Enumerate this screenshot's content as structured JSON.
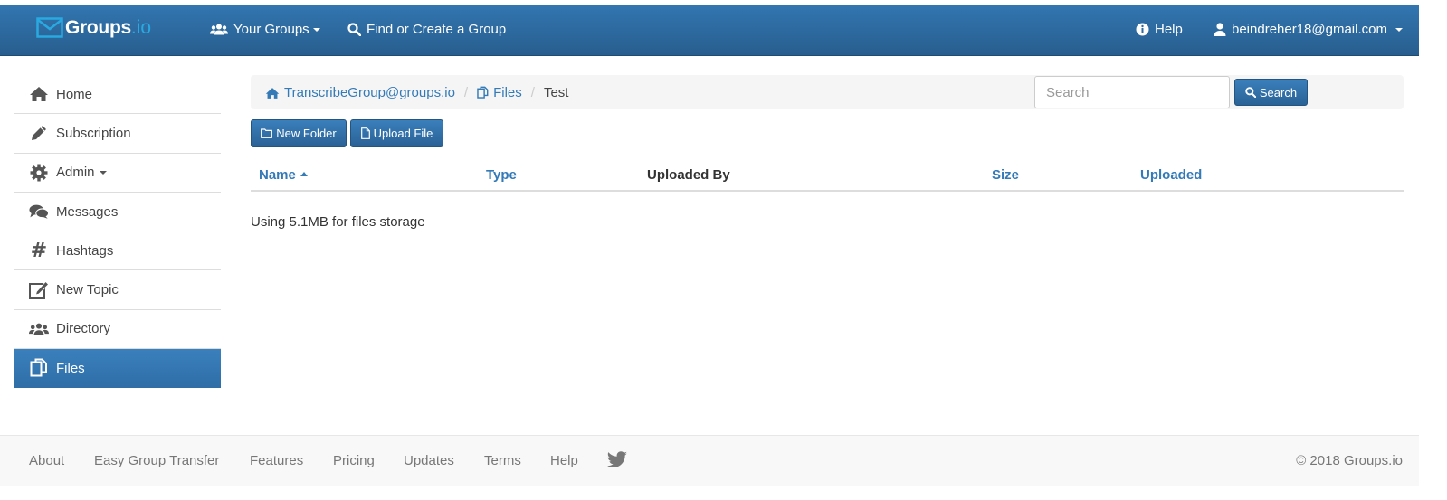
{
  "navbar": {
    "brand": "Groups",
    "brand_suffix": ".io",
    "your_groups": "Your Groups",
    "find_create": "Find or Create a Group",
    "help": "Help",
    "user_email": "beindreher18@gmail.com"
  },
  "sidebar": {
    "items": [
      {
        "label": "Home",
        "icon": "home-icon"
      },
      {
        "label": "Subscription",
        "icon": "pencil-icon"
      },
      {
        "label": "Admin",
        "icon": "gear-icon"
      },
      {
        "label": "Messages",
        "icon": "chat-icon"
      },
      {
        "label": "Hashtags",
        "icon": "hashtag-icon"
      },
      {
        "label": "New Topic",
        "icon": "edit-icon"
      },
      {
        "label": "Directory",
        "icon": "users-icon"
      },
      {
        "label": "Files",
        "icon": "files-icon"
      }
    ],
    "active": "Files"
  },
  "breadcrumb": {
    "group": "TranscribeGroup@groups.io",
    "files": "Files",
    "current": "Test",
    "separator": "/"
  },
  "search": {
    "placeholder": "Search",
    "button": "Search"
  },
  "toolbar": {
    "new_folder": "New Folder",
    "upload_file": "Upload File"
  },
  "table": {
    "columns": [
      "Name",
      "Type",
      "Uploaded By",
      "Size",
      "Uploaded"
    ],
    "sorted_by": "Name"
  },
  "storage_text": "Using 5.1MB for files storage",
  "footer": {
    "links": [
      "About",
      "Easy Group Transfer",
      "Features",
      "Pricing",
      "Updates",
      "Terms",
      "Help"
    ],
    "copyright": "© 2018 Groups.io"
  },
  "colors": {
    "navbar": "#3276b1",
    "link": "#337ab7",
    "active_item": "#3a80bd",
    "brand_accent": "#29a9e0"
  }
}
